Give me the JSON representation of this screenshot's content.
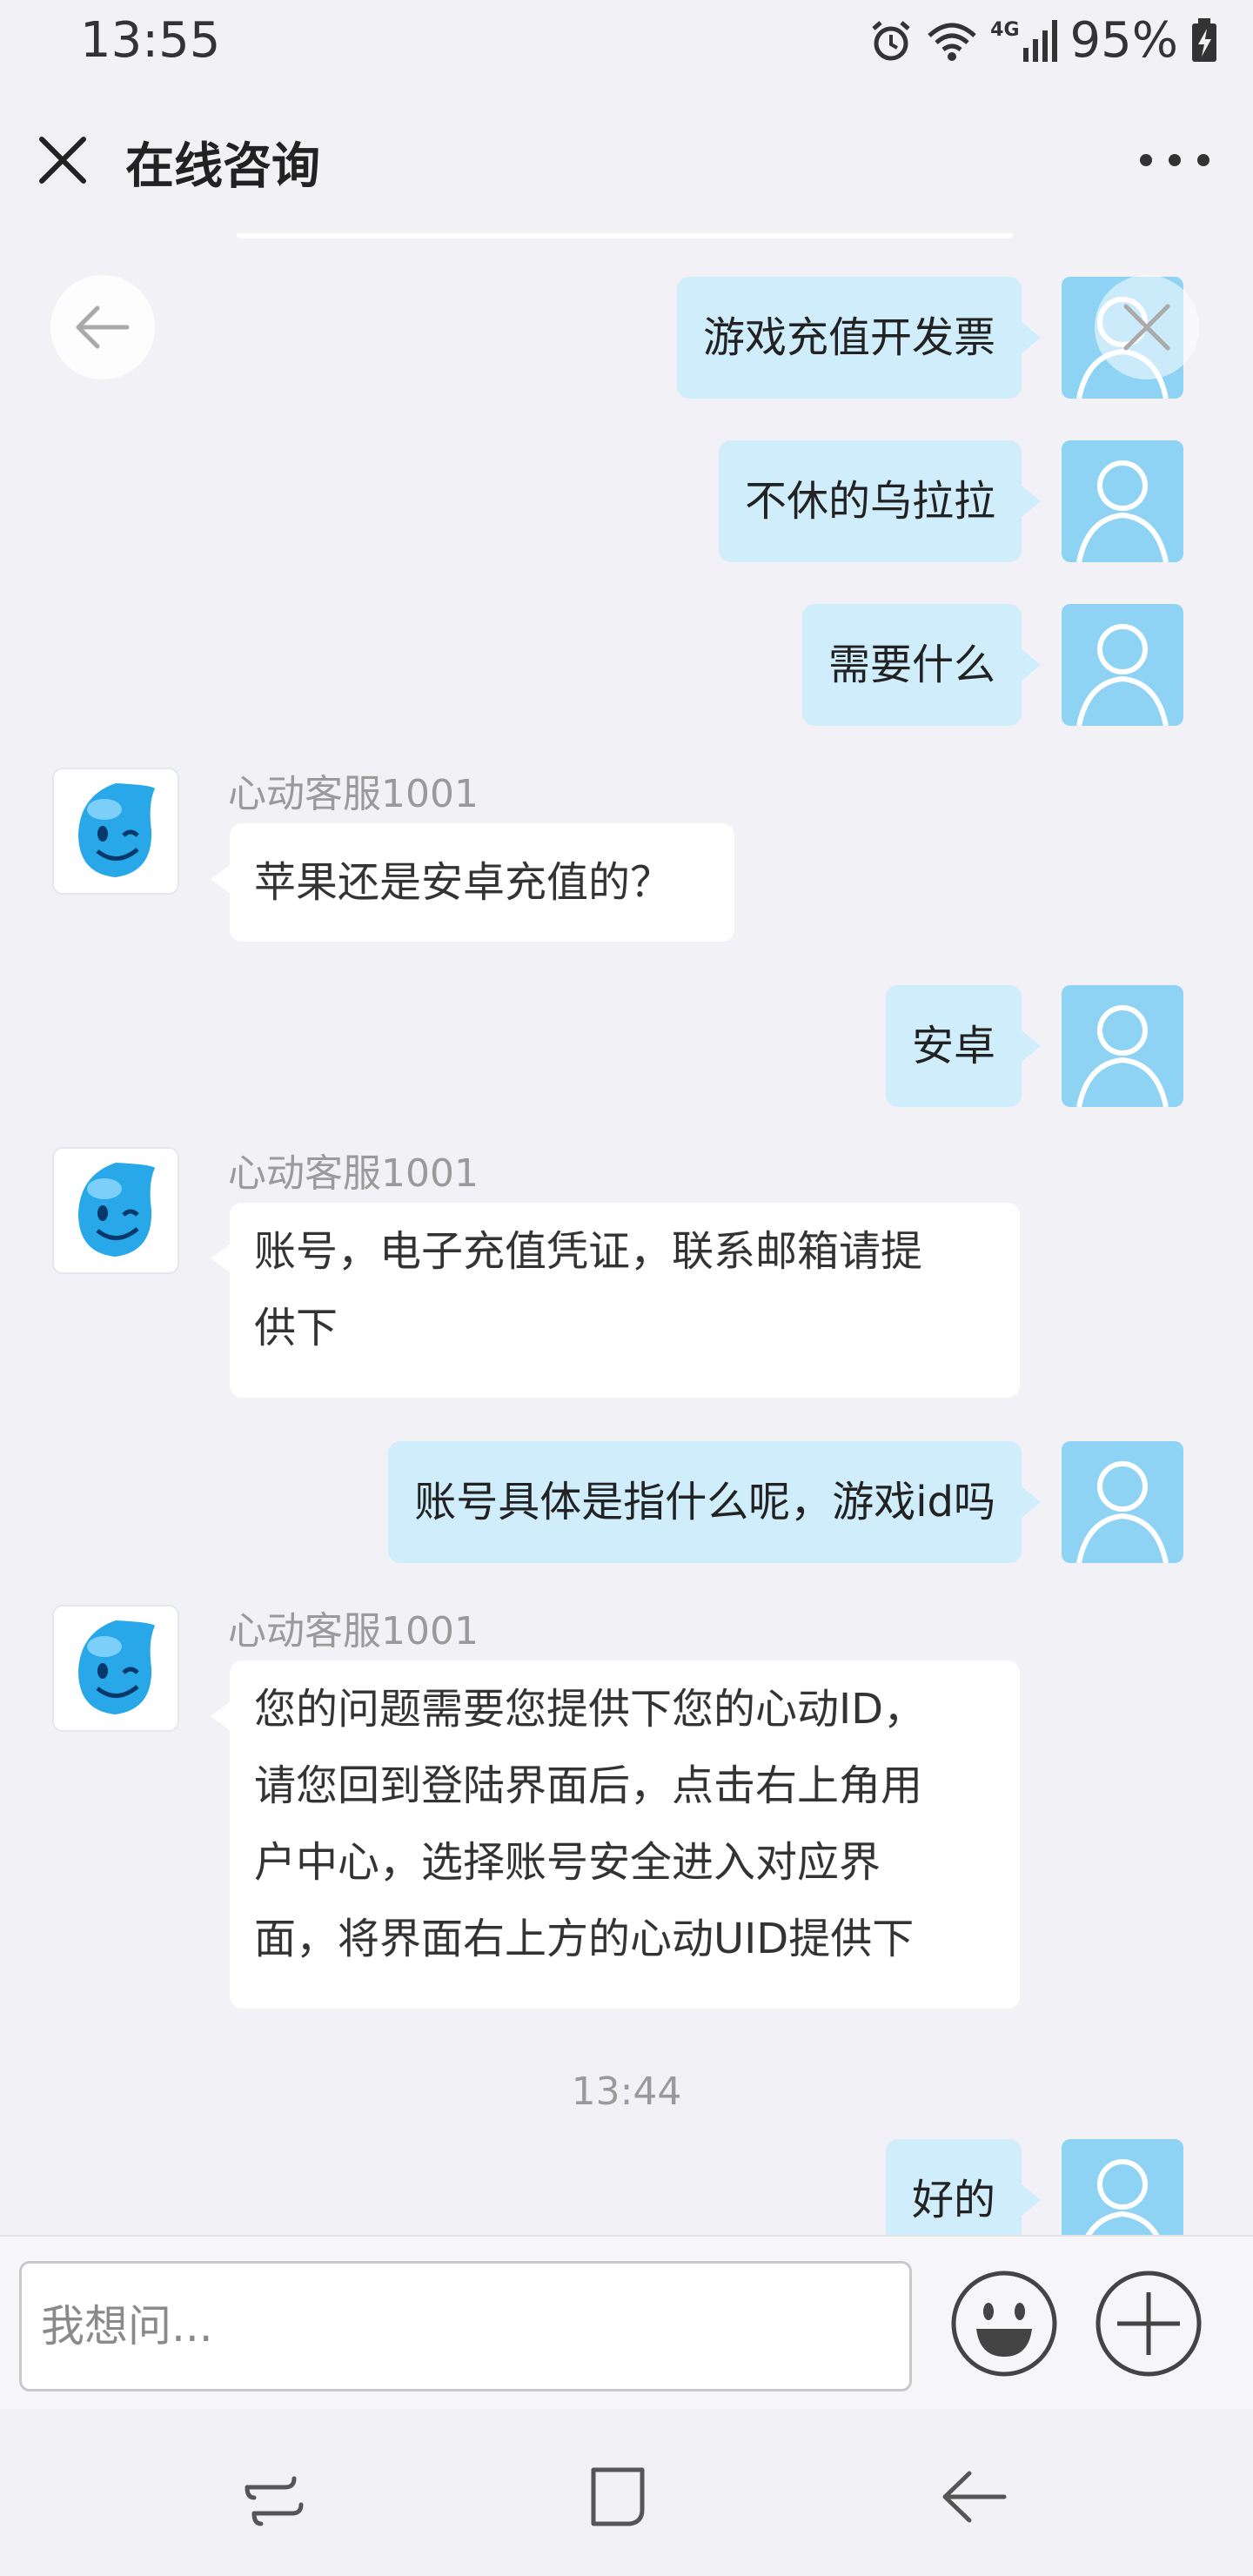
{
  "status_bar": {
    "time": "13:55",
    "battery_percent": "95%",
    "network": "4G",
    "icons": [
      "alarm-icon",
      "wifi-icon",
      "signal-icon",
      "battery-icon"
    ]
  },
  "header": {
    "title": "在线咨询",
    "close_icon": "close-icon",
    "more_icon": "more-icon"
  },
  "messages": [
    {
      "from": "user",
      "text": "游戏充值开发票"
    },
    {
      "from": "user",
      "text": "不休的乌拉拉"
    },
    {
      "from": "user",
      "text": "需要什么"
    },
    {
      "from": "agent",
      "name": "心动客服1001",
      "text": "苹果还是安卓充值的？"
    },
    {
      "from": "user",
      "text": "安卓"
    },
    {
      "from": "agent",
      "name": "心动客服1001",
      "lines": [
        "账号，电子充值凭证，联系邮箱请提",
        "供下"
      ]
    },
    {
      "from": "user",
      "text": "账号具体是指什么呢，游戏id吗"
    },
    {
      "from": "agent",
      "name": "心动客服1001",
      "lines": [
        "您的问题需要您提供下您的心动ID，",
        "请您回到登陆界面后，点击右上角用",
        "户中心，选择账号安全进入对应界",
        "面，将界面右上方的心动UID提供下"
      ]
    },
    {
      "from": "system",
      "text": "13:44"
    },
    {
      "from": "user",
      "text": "好的"
    }
  ],
  "input": {
    "placeholder": "我想问...",
    "value": "",
    "emoji_icon": "emoji-icon",
    "plus_icon": "plus-icon"
  },
  "nav_bar": {
    "icons": [
      "recent-apps-icon",
      "home-icon",
      "back-icon"
    ]
  },
  "colors": {
    "user_bubble": "#cfedfb",
    "user_avatar": "#8fd3f4",
    "agent_bubble": "#ffffff",
    "background": "#f2f2f6"
  }
}
